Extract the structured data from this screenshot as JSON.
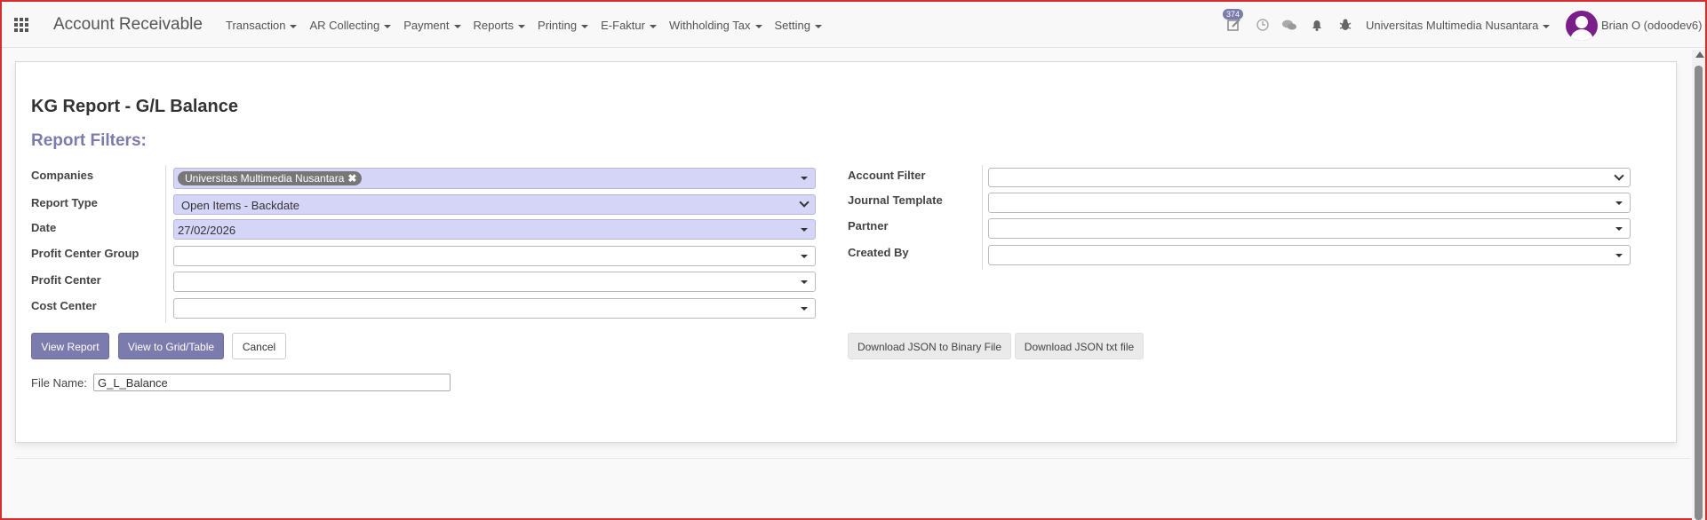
{
  "navbar": {
    "app_title": "Account Receivable",
    "menus": [
      "Transaction",
      "AR Collecting",
      "Payment",
      "Reports",
      "Printing",
      "E-Faktur",
      "Withholding Tax",
      "Setting"
    ],
    "activity_count": "374",
    "company": "Universitas Multimedia Nusantara",
    "user": "Brian O (odoodev6)"
  },
  "form": {
    "title": "KG Report - G/L Balance",
    "section": "Report Filters:",
    "left": {
      "companies_label": "Companies",
      "companies_tag": "Universitas Multimedia Nusantara",
      "report_type_label": "Report Type",
      "report_type_value": "Open Items - Backdate",
      "date_label": "Date",
      "date_value": "27/02/2026",
      "profit_center_group_label": "Profit Center Group",
      "profit_center_group_value": "",
      "profit_center_label": "Profit Center",
      "profit_center_value": "",
      "cost_center_label": "Cost Center",
      "cost_center_value": ""
    },
    "right": {
      "account_filter_label": "Account Filter",
      "account_filter_value": "",
      "journal_template_label": "Journal Template",
      "journal_template_value": "",
      "partner_label": "Partner",
      "partner_value": "",
      "created_by_label": "Created By",
      "created_by_value": ""
    },
    "buttons": {
      "view_report": "View Report",
      "view_grid": "View to Grid/Table",
      "cancel": "Cancel",
      "download_binary": "Download JSON to Binary File",
      "download_txt": "Download JSON txt file"
    },
    "file_name_label": "File Name:",
    "file_name_value": "G_L_Balance"
  },
  "colors": {
    "accent": "#7c7bad",
    "filled_field": "#d5d5f7",
    "border_frame": "#d32f2f"
  }
}
